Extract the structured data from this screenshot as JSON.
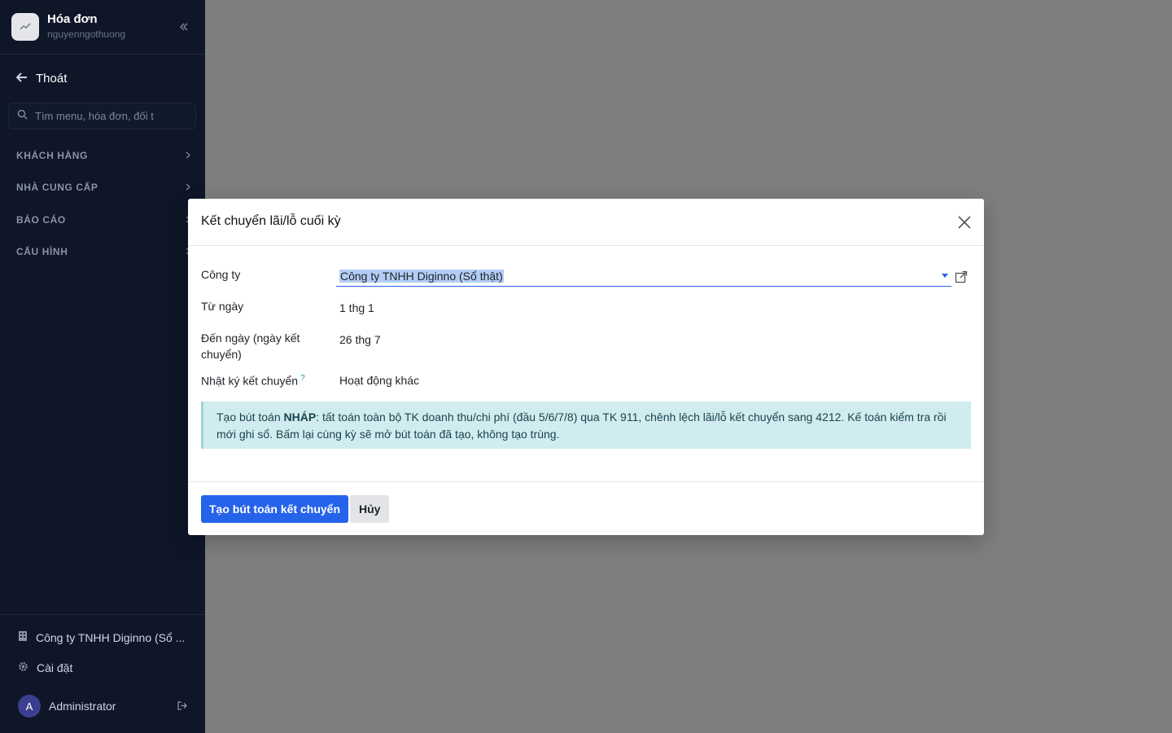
{
  "sidebar": {
    "app_title": "Hóa đơn",
    "app_user": "nguyenngothuong",
    "back_label": "Thoát",
    "search": {
      "placeholder": "Tìm menu, hóa đơn, đối t"
    },
    "nav_items": [
      {
        "label": "KHÁCH HÀNG"
      },
      {
        "label": "NHÀ CUNG CẤP"
      },
      {
        "label": "BÁO CÁO"
      },
      {
        "label": "CẤU HÌNH"
      }
    ],
    "footer": {
      "company": "Công ty TNHH Diginno (Sổ ...",
      "settings": "Cài đặt",
      "avatar_letter": "A",
      "user": "Administrator"
    }
  },
  "modal": {
    "title": "Kết chuyển lãi/lỗ cuối kỳ",
    "fields": {
      "company_label": "Công ty",
      "company_value": "Công ty TNHH Diginno (Sổ thật)",
      "from_label": "Từ ngày",
      "from_value": "1 thg 1",
      "to_label": "Đến ngày (ngày kết chuyển)",
      "to_value": "26 thg 7",
      "journal_label": "Nhật ký kết chuyển",
      "journal_help": "?",
      "journal_value": "Hoạt động khác"
    },
    "alert": {
      "prefix": "Tạo bút toán ",
      "bold": "NHÁP",
      "rest": ": tất toán toàn bộ TK doanh thu/chi phí (đầu 5/6/7/8) qua TK 911, chênh lệch lãi/lỗ kết chuyển sang 4212. Kế toán kiểm tra rồi mới ghi sổ. Bấm lại cùng kỳ sẽ mở bút toán đã tạo, không tạo trùng."
    },
    "buttons": {
      "primary": "Tạo bút toán kết chuyển",
      "cancel": "Hủy"
    }
  },
  "colors": {
    "sidebar_bg": "#0f1628",
    "accent": "#2563eb",
    "overlay": "#7f7f7f",
    "alert_bg": "#d1ecee"
  }
}
